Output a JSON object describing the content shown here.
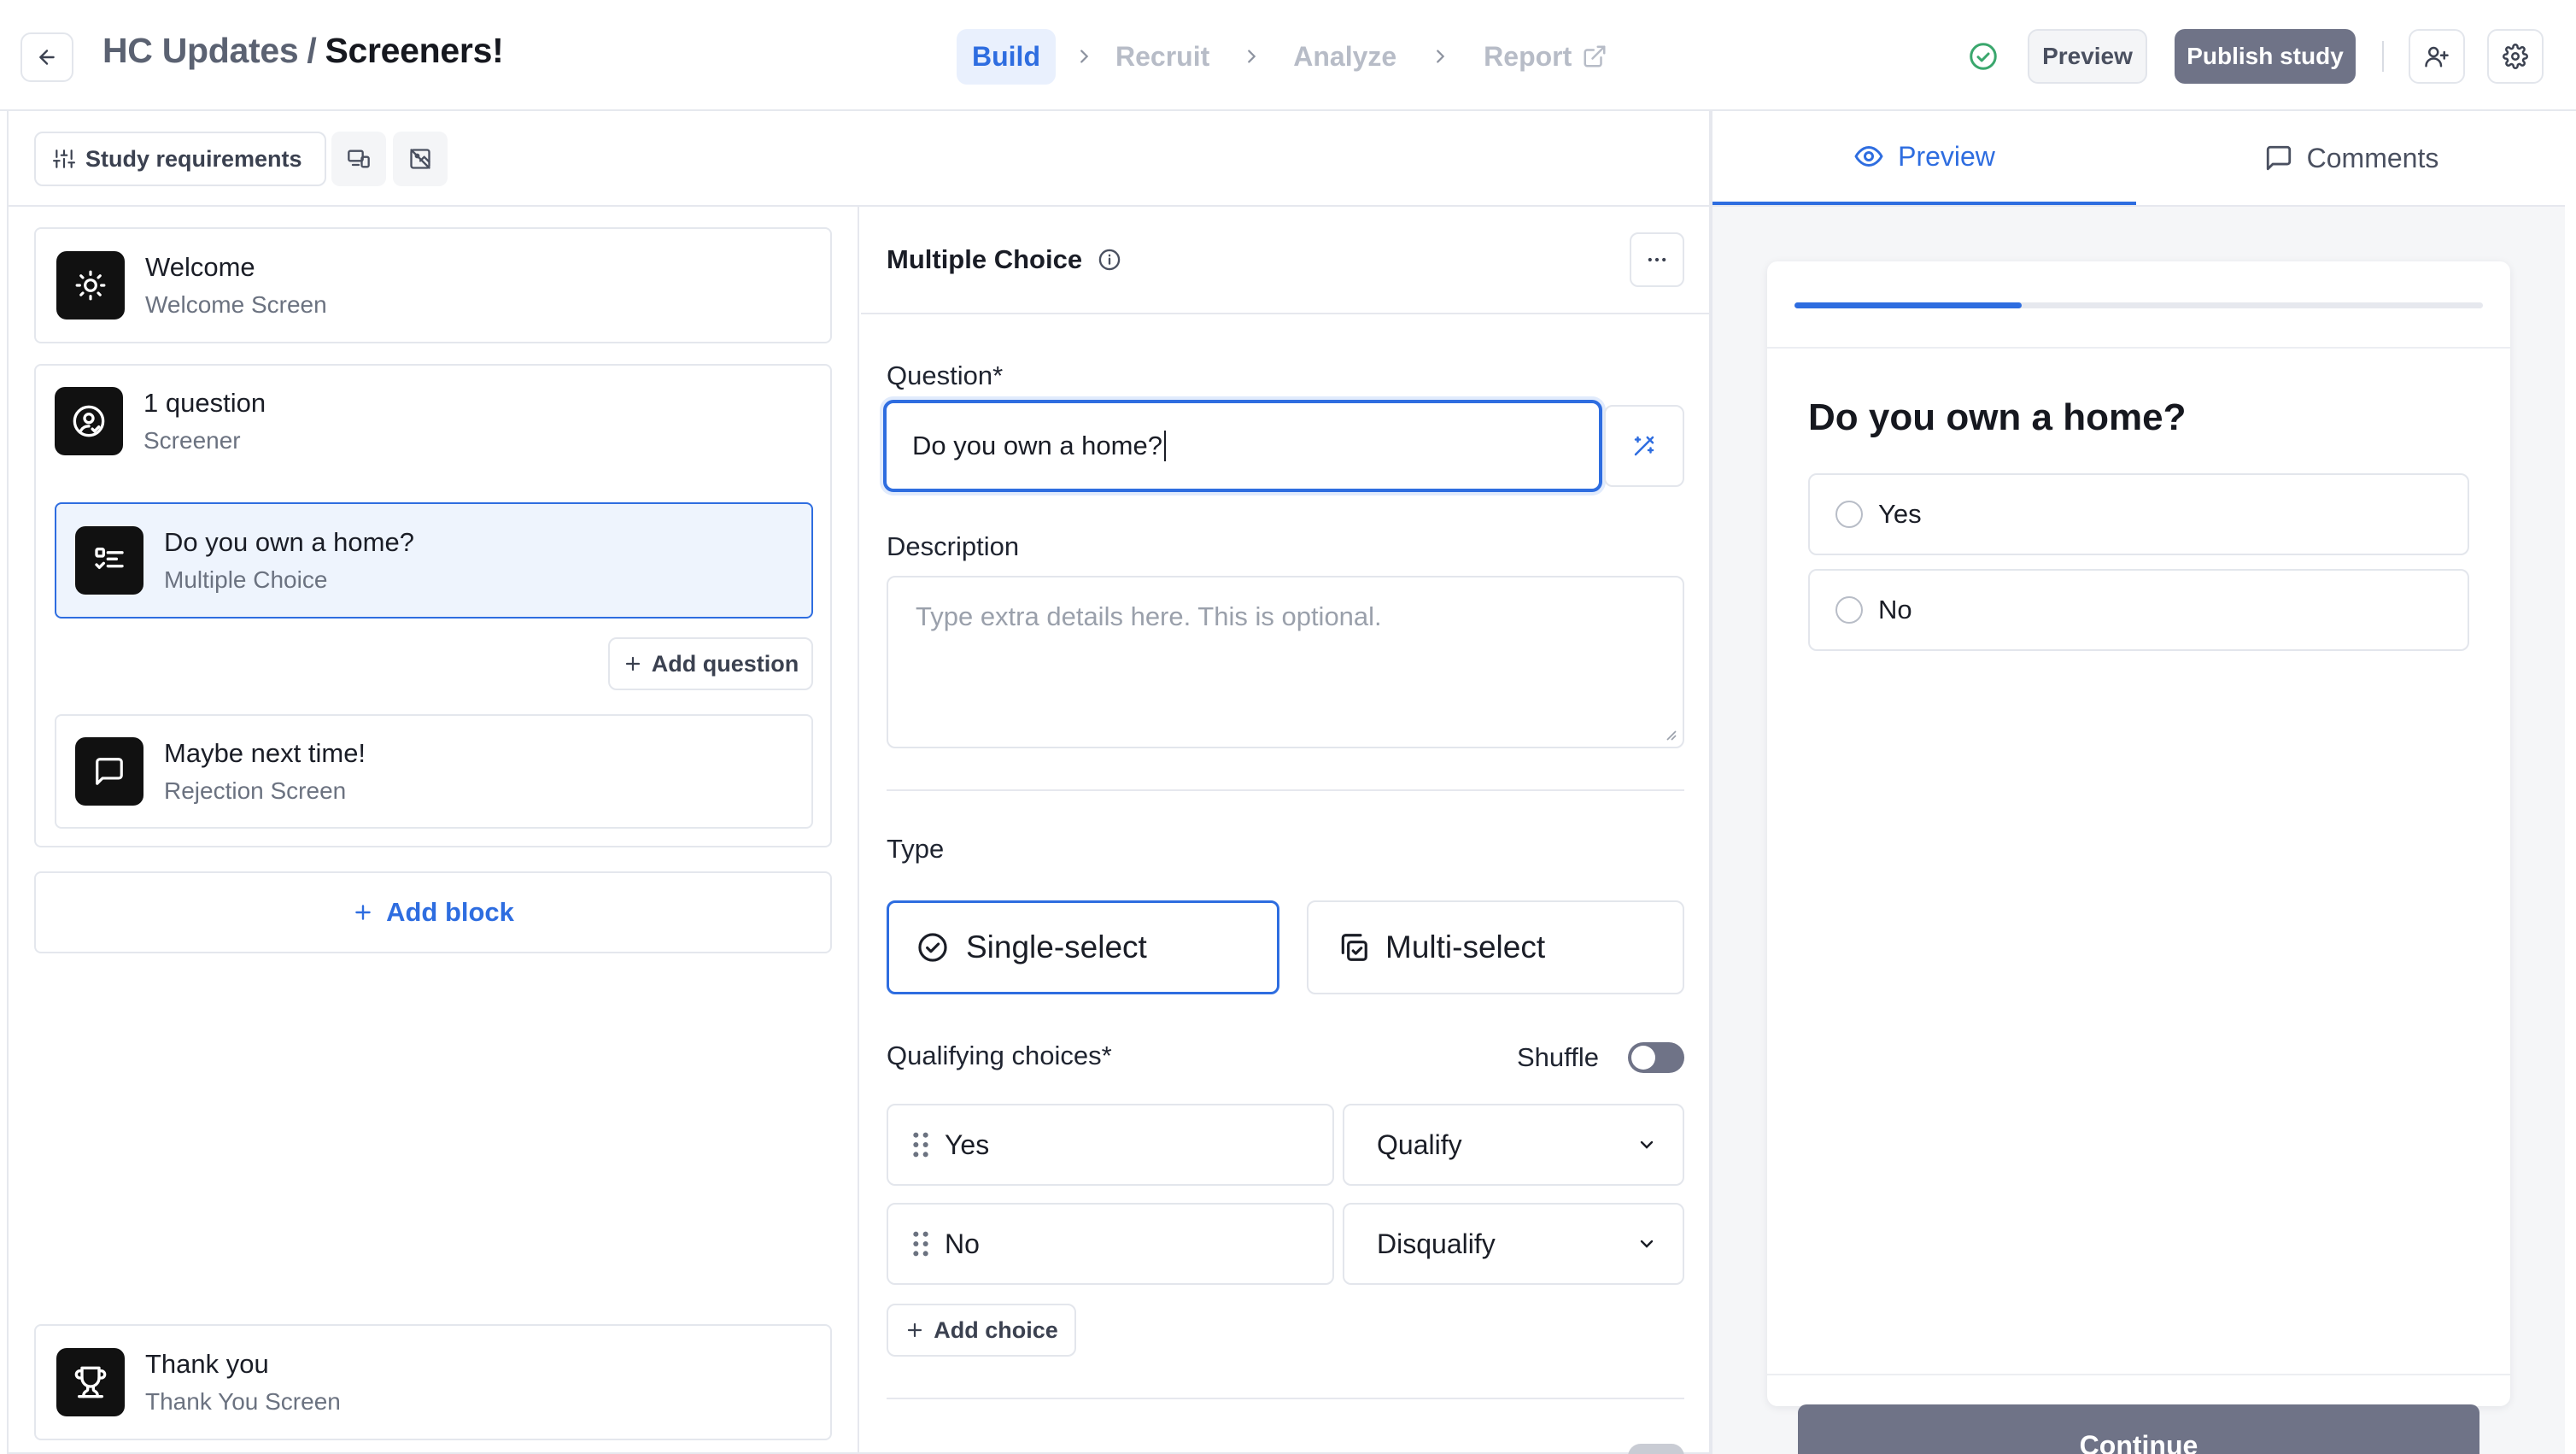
{
  "header": {
    "back_icon": "arrow-left-icon",
    "breadcrumb_parent": "HC Updates",
    "breadcrumb_sep": "/",
    "title": "Screeners!",
    "steps": [
      {
        "label": "Build",
        "active": true
      },
      {
        "label": "Recruit",
        "active": false
      },
      {
        "label": "Analyze",
        "active": false
      },
      {
        "label": "Report",
        "active": false
      }
    ],
    "preview_label": "Preview",
    "publish_label": "Publish study",
    "status_icon": "check-circle-icon"
  },
  "toolbar": {
    "requirements_label": "Study requirements"
  },
  "outline": {
    "welcome": {
      "title": "Welcome",
      "subtitle": "Welcome Screen"
    },
    "screener": {
      "title": "1 question",
      "subtitle": "Screener"
    },
    "question": {
      "title": "Do you own a home?",
      "subtitle": "Multiple Choice"
    },
    "add_question_label": "Add question",
    "rejection": {
      "title": "Maybe next time!",
      "subtitle": "Rejection Screen"
    },
    "add_block_label": "Add block",
    "thankyou": {
      "title": "Thank you",
      "subtitle": "Thank You Screen"
    }
  },
  "editor": {
    "heading": "Multiple Choice",
    "question_label": "Question*",
    "question_value": "Do you own a home?",
    "description_label": "Description",
    "description_placeholder": "Type extra details here. This is optional.",
    "type_label": "Type",
    "single_select_label": "Single-select",
    "multi_select_label": "Multi-select",
    "selected_type": "Single-select",
    "qualifying_label": "Qualifying choices*",
    "shuffle_label": "Shuffle",
    "shuffle_on": false,
    "choices": [
      {
        "text": "Yes",
        "rule": "Qualify"
      },
      {
        "text": "No",
        "rule": "Disqualify"
      }
    ],
    "add_choice_label": "Add choice"
  },
  "preview": {
    "tab_preview": "Preview",
    "tab_comments": "Comments",
    "progress": 0.33,
    "question": "Do you own a home?",
    "options": [
      "Yes",
      "No"
    ],
    "continue_label": "Continue"
  },
  "colors": {
    "accent": "#2e6de0",
    "primary_button": "#6f7387",
    "status_green": "#3aa76d"
  }
}
